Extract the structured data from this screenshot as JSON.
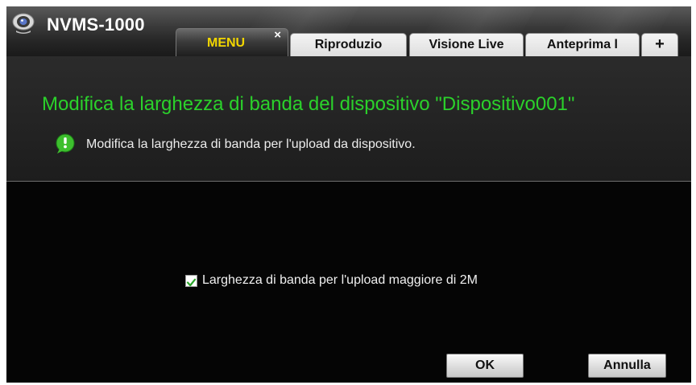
{
  "app": {
    "title": "NVMS-1000",
    "icon": "webcam-icon"
  },
  "tabs": [
    {
      "label": "MENU",
      "active": true,
      "closable": true,
      "close_label": "×"
    },
    {
      "label": "Riproduzio",
      "active": false
    },
    {
      "label": "Visione Live",
      "active": false
    },
    {
      "label": "Anteprima l",
      "active": false
    }
  ],
  "add_tab": {
    "label": "+"
  },
  "dialog": {
    "title": "Modifica la larghezza di banda del dispositivo \"Dispositivo001\"",
    "tip_icon": "info-bubble-icon",
    "tip": "Modifica la larghezza di banda per l'upload da dispositivo.",
    "option": {
      "label": "Larghezza di banda per l'upload maggiore di 2M",
      "checked": true
    },
    "ok_label": "OK",
    "cancel_label": "Annulla"
  },
  "colors": {
    "title_green": "#2bd12b",
    "active_tab_text": "#f2d600",
    "background": "#050505"
  }
}
